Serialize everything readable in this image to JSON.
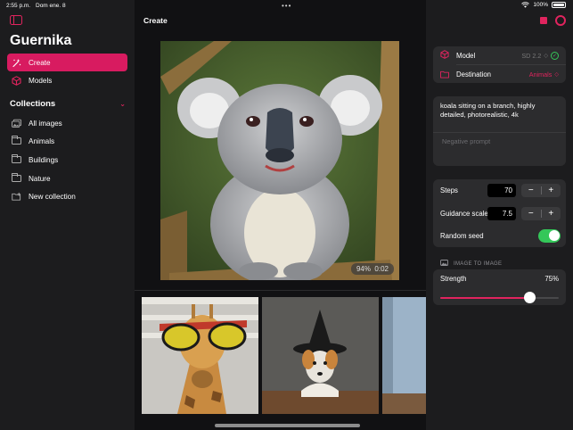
{
  "status_bar": {
    "time": "2:55 p.m.",
    "date": "Dom ene. 8",
    "battery": "100%"
  },
  "sidebar": {
    "app_title": "Guernika",
    "nav": [
      {
        "label": "Create",
        "icon": "magic-wand-icon",
        "active": true
      },
      {
        "label": "Models",
        "icon": "cube-icon",
        "active": false
      }
    ],
    "collections_header": "Collections",
    "collections": [
      {
        "label": "All images",
        "icon": "photos-icon"
      },
      {
        "label": "Animals",
        "icon": "folder-icon"
      },
      {
        "label": "Buildings",
        "icon": "folder-icon"
      },
      {
        "label": "Nature",
        "icon": "folder-icon"
      },
      {
        "label": "New collection",
        "icon": "folder-add-icon"
      }
    ]
  },
  "main": {
    "title": "Create",
    "progress": "94%",
    "elapsed": "0:02",
    "progress_fraction": 0.94
  },
  "panel": {
    "model_label": "Model",
    "model_value": "SD 2.2",
    "destination_label": "Destination",
    "destination_value": "Animals",
    "prompt": "koala sitting on a branch, highly detailed, photorealistic, 4k",
    "negative_prompt_placeholder": "Negative prompt",
    "steps_label": "Steps",
    "steps_value": "70",
    "guidance_label": "Guidance scale",
    "guidance_value": "7.5",
    "random_seed_label": "Random seed",
    "random_seed_on": true,
    "image_to_image_header": "IMAGE TO IMAGE",
    "strength_label": "Strength",
    "strength_value": "75%",
    "strength_fraction": 0.75
  },
  "colors": {
    "accent": "#e0245e",
    "toggle_on": "#34c759",
    "sidebar_bg": "#1c1c1e"
  }
}
